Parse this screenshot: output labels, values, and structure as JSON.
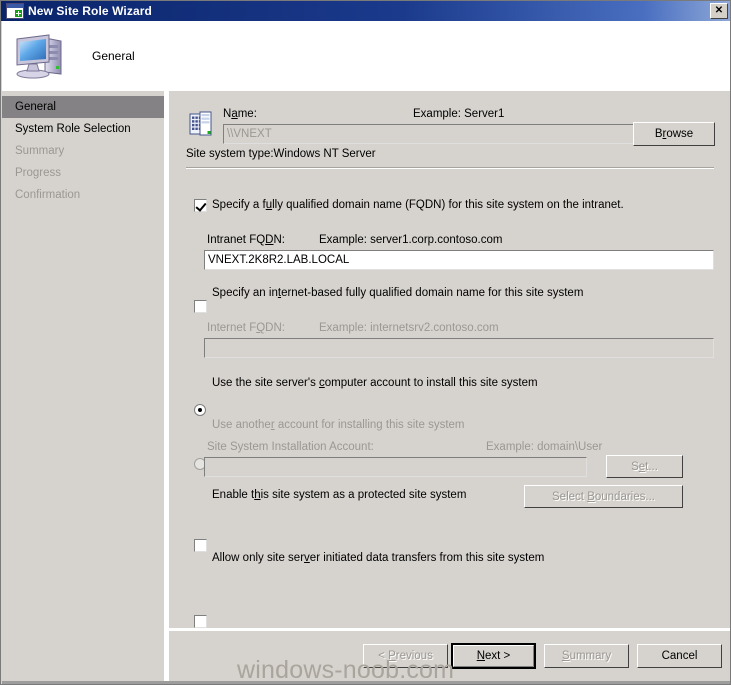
{
  "window": {
    "title": "New Site Role Wizard",
    "title_icon": "window-new-icon",
    "close_label": "✕"
  },
  "header": {
    "icon": "computer-icon",
    "title": "General"
  },
  "sidebar": {
    "items": [
      {
        "label": "General",
        "state": "active"
      },
      {
        "label": "System Role Selection",
        "state": "enabled"
      },
      {
        "label": "Summary",
        "state": "disabled"
      },
      {
        "label": "Progress",
        "state": "disabled"
      },
      {
        "label": "Confirmation",
        "state": "disabled"
      }
    ]
  },
  "main": {
    "server_icon": "server-icon",
    "name_label": "Name:",
    "name_example": "Example: Server1",
    "name_value": "\\\\VNEXT",
    "site_system_type": "Site system type:Windows NT Server",
    "browse_button": "Browse",
    "intranet_checkbox_label": "Specify a fully qualified domain name (FQDN) for this site system on the intranet.",
    "intranet_checkbox_checked": true,
    "intranet_fqdn_label": "Intranet FQDN:",
    "intranet_fqdn_example": "Example: server1.corp.contoso.com",
    "intranet_fqdn_value": "VNEXT.2K8R2.LAB.LOCAL",
    "internet_checkbox_label": "Specify an internet-based fully qualified domain name for this site system",
    "internet_checkbox_checked": false,
    "internet_fqdn_label": "Internet FQDN:",
    "internet_fqdn_example": "Example: internetsrv2.contoso.com",
    "internet_fqdn_value": "",
    "radio_computer_account_label": "Use the site server's computer account to install this site system",
    "radio_computer_account_selected": true,
    "radio_another_account_label": "Use another account for installing this site system",
    "radio_another_account_selected": false,
    "installation_account_label": "Site System Installation Account:",
    "installation_account_example": "Example: domain\\User",
    "installation_account_value": "",
    "set_button": "Set...",
    "protected_checkbox_label": "Enable this site system as a protected site system",
    "protected_checkbox_checked": false,
    "select_boundaries_button": "Select Boundaries...",
    "allow_only_checkbox_label": "Allow only site server initiated data transfers from this site system",
    "allow_only_checkbox_checked": false
  },
  "footer": {
    "previous_button": "< Previous",
    "next_button": "Next >",
    "summary_button": "Summary",
    "cancel_button": "Cancel"
  },
  "watermark": {
    "text": "windows-noob.com"
  },
  "colors": {
    "titlebar_start": "#0a246a",
    "titlebar_end": "#8fa9d8",
    "dialog_face": "#d6d3ce",
    "highlight_red": "#ff0000",
    "nav_active_bg": "#848284",
    "disabled_text": "#9b9792"
  }
}
